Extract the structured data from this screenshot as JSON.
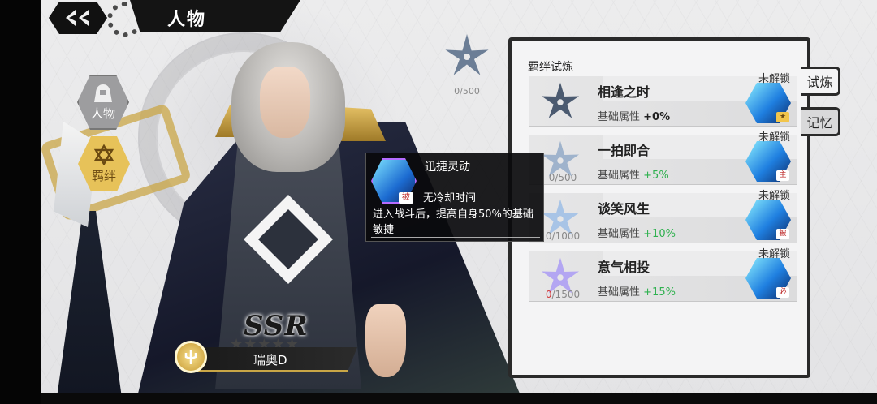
{
  "header": {
    "title": "人物",
    "back_icon": "back-arrow-icon"
  },
  "left_menu": [
    {
      "label": "人物",
      "icon": "hooded-figure-icon",
      "selected": false
    },
    {
      "label": "羁绊",
      "icon": "star-of-david-icon",
      "selected": true
    }
  ],
  "character": {
    "rarity": "SSR",
    "stars": "★★★★★",
    "name": "瑞奥D",
    "role_icon": "trident-icon"
  },
  "top_counter": {
    "text": "0/500"
  },
  "tooltip": {
    "title": "迅捷灵动",
    "tag": "被",
    "cooldown": "无冷却时间",
    "description": "进入战斗后，提高自身50%的基础敏捷",
    "icon": "blade-skill-icon"
  },
  "panel": {
    "title": "羁绊试炼",
    "entries": [
      {
        "name": "相逢之时",
        "attr_label": "基础属性",
        "attr_value": "+0%",
        "lock": "未解锁",
        "progress": "",
        "skill_tag": "",
        "color": "#5b6a80"
      },
      {
        "name": "一拍即合",
        "attr_label": "基础属性",
        "attr_value": "+5%",
        "lock": "未解锁",
        "progress": "0/500",
        "skill_tag": "主",
        "color": "#9fb3cc"
      },
      {
        "name": "谈笑风生",
        "attr_label": "基础属性",
        "attr_value": "+10%",
        "lock": "未解锁",
        "progress": "0/1000",
        "skill_tag": "被",
        "color": "#a8c4e6"
      },
      {
        "name": "意气相投",
        "attr_label": "基础属性",
        "attr_value": "+15%",
        "lock": "未解锁",
        "progress_zero": "0",
        "progress_rest": "/1500",
        "skill_tag": "必",
        "color": "#b3a6f2"
      }
    ]
  },
  "side_tabs": [
    {
      "label": "试炼",
      "active": true
    },
    {
      "label": "记忆",
      "active": false
    }
  ]
}
